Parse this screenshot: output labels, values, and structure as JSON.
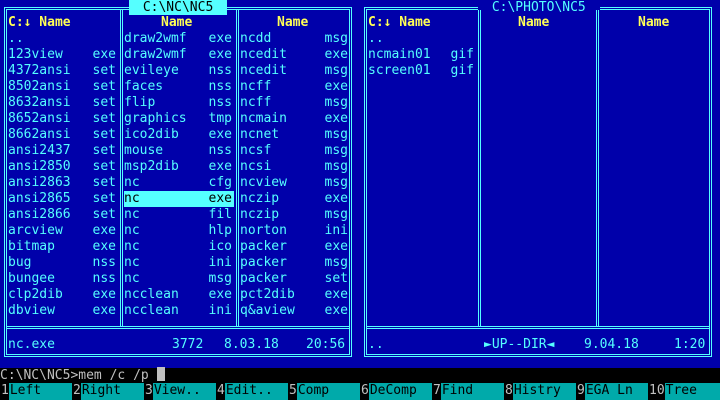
{
  "left_panel": {
    "title": " C:\\NC\\NC5 ",
    "headers": [
      "C:↓ Name",
      "Name",
      "Name"
    ],
    "columns": [
      [
        {
          "name": "..",
          "ext": ""
        },
        {
          "name": "123view",
          "ext": "exe"
        },
        {
          "name": "4372ansi",
          "ext": "set"
        },
        {
          "name": "8502ansi",
          "ext": "set"
        },
        {
          "name": "8632ansi",
          "ext": "set"
        },
        {
          "name": "8652ansi",
          "ext": "set"
        },
        {
          "name": "8662ansi",
          "ext": "set"
        },
        {
          "name": "ansi2437",
          "ext": "set"
        },
        {
          "name": "ansi2850",
          "ext": "set"
        },
        {
          "name": "ansi2863",
          "ext": "set"
        },
        {
          "name": "ansi2865",
          "ext": "set"
        },
        {
          "name": "ansi2866",
          "ext": "set"
        },
        {
          "name": "arcview",
          "ext": "exe"
        },
        {
          "name": "bitmap",
          "ext": "exe"
        },
        {
          "name": "bug",
          "ext": "nss"
        },
        {
          "name": "bungee",
          "ext": "nss"
        },
        {
          "name": "clp2dib",
          "ext": "exe"
        },
        {
          "name": "dbview",
          "ext": "exe"
        }
      ],
      [
        {
          "name": "draw2wmf",
          "ext": "exe"
        },
        {
          "name": "draw2wmf",
          "ext": "exe"
        },
        {
          "name": "evileye",
          "ext": "nss"
        },
        {
          "name": "faces",
          "ext": "nss"
        },
        {
          "name": "flip",
          "ext": "nss"
        },
        {
          "name": "graphics",
          "ext": "tmp"
        },
        {
          "name": "ico2dib",
          "ext": "exe"
        },
        {
          "name": "mouse",
          "ext": "nss"
        },
        {
          "name": "msp2dib",
          "ext": "exe"
        },
        {
          "name": "nc",
          "ext": "cfg"
        },
        {
          "name": "nc",
          "ext": "exe",
          "selected": true
        },
        {
          "name": "nc",
          "ext": "fil"
        },
        {
          "name": "nc",
          "ext": "hlp"
        },
        {
          "name": "nc",
          "ext": "ico"
        },
        {
          "name": "nc",
          "ext": "ini"
        },
        {
          "name": "nc",
          "ext": "msg"
        },
        {
          "name": "ncclean",
          "ext": "exe"
        },
        {
          "name": "ncclean",
          "ext": "ini"
        }
      ],
      [
        {
          "name": "ncdd",
          "ext": "msg"
        },
        {
          "name": "ncedit",
          "ext": "exe"
        },
        {
          "name": "ncedit",
          "ext": "msg"
        },
        {
          "name": "ncff",
          "ext": "exe"
        },
        {
          "name": "ncff",
          "ext": "msg"
        },
        {
          "name": "ncmain",
          "ext": "exe"
        },
        {
          "name": "ncnet",
          "ext": "msg"
        },
        {
          "name": "ncsf",
          "ext": "msg"
        },
        {
          "name": "ncsi",
          "ext": "msg"
        },
        {
          "name": "ncview",
          "ext": "msg"
        },
        {
          "name": "nczip",
          "ext": "exe"
        },
        {
          "name": "nczip",
          "ext": "msg"
        },
        {
          "name": "norton",
          "ext": "ini"
        },
        {
          "name": "packer",
          "ext": "exe"
        },
        {
          "name": "packer",
          "ext": "msg"
        },
        {
          "name": "packer",
          "ext": "set"
        },
        {
          "name": "pct2dib",
          "ext": "exe"
        },
        {
          "name": "q&aview",
          "ext": "exe"
        }
      ]
    ],
    "status": {
      "name": "nc.exe",
      "size": "3772",
      "date": "8.03.18",
      "time": "20:56"
    }
  },
  "right_panel": {
    "title": " C:\\PHOTO\\NC5 ",
    "headers": [
      "C:↓ Name",
      "Name",
      "Name"
    ],
    "columns": [
      [
        {
          "name": "..",
          "ext": ""
        },
        {
          "name": "ncmain01",
          "ext": "gif"
        },
        {
          "name": "screen01",
          "ext": "gif"
        }
      ],
      [],
      []
    ],
    "status": {
      "name": "..",
      "size": "►UP--DIR◄",
      "date": "9.04.18",
      "time": "1:20"
    }
  },
  "command_line": {
    "prompt": "C:\\NC\\NC5>",
    "value": "mem /c /p"
  },
  "fkeys": [
    {
      "num": "1",
      "label": "Left"
    },
    {
      "num": "2",
      "label": "Right"
    },
    {
      "num": "3",
      "label": "View.."
    },
    {
      "num": "4",
      "label": "Edit.."
    },
    {
      "num": "5",
      "label": "Comp"
    },
    {
      "num": "6",
      "label": "DeComp"
    },
    {
      "num": "7",
      "label": "Find"
    },
    {
      "num": "8",
      "label": "Histry"
    },
    {
      "num": "9",
      "label": "EGA Ln"
    },
    {
      "num": "10",
      "label": "Tree"
    }
  ],
  "colors": {
    "panel_bg": "#0000aa",
    "text": "#55ffff",
    "header": "#ffff55",
    "fkey_bg": "#00aaaa"
  }
}
